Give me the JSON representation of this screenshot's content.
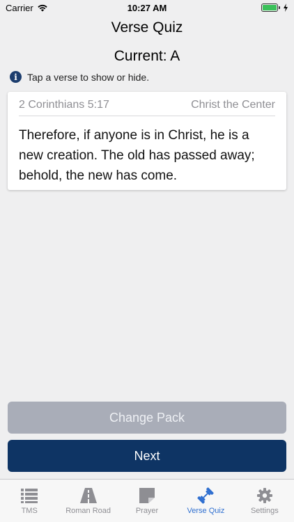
{
  "status": {
    "carrier": "Carrier",
    "time": "10:27 AM"
  },
  "nav": {
    "title": "Verse Quiz"
  },
  "quiz": {
    "current": "Current: A",
    "hint": "Tap a verse to show or hide."
  },
  "verse": {
    "reference": "2 Corinthians 5:17",
    "topic": "Christ the Center",
    "text": "Therefore, if anyone is in Christ, he is a new creation. The old has passed away; behold, the new has come."
  },
  "buttons": {
    "change_pack": "Change Pack",
    "next": "Next"
  },
  "tabs": [
    {
      "label": "TMS",
      "icon": "list-icon"
    },
    {
      "label": "Roman Road",
      "icon": "road-icon"
    },
    {
      "label": "Prayer",
      "icon": "sticky-note-icon"
    },
    {
      "label": "Verse Quiz",
      "icon": "dumbbell-icon",
      "active": true
    },
    {
      "label": "Settings",
      "icon": "gear-icon"
    }
  ],
  "colors": {
    "accent": "#0e3464",
    "active_tab": "#2f6fd0",
    "disabled_button": "#a9adb8"
  }
}
